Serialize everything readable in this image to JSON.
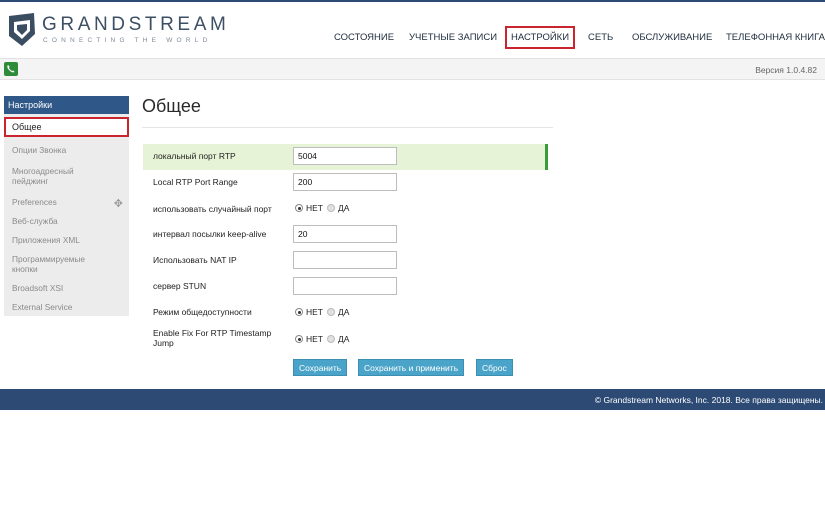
{
  "brand": {
    "name": "GRANDSTREAM",
    "tagline": "CONNECTING THE WORLD"
  },
  "nav": {
    "items": [
      {
        "label": "СОСТОЯНИЕ",
        "active": false
      },
      {
        "label": "УЧЕТНЫЕ ЗАПИСИ",
        "active": false
      },
      {
        "label": "НАСТРОЙКИ",
        "active": true
      },
      {
        "label": "СЕТЬ",
        "active": false
      },
      {
        "label": "ОБСЛУЖИВАНИЕ",
        "active": false
      },
      {
        "label": "ТЕЛЕФОННАЯ КНИГА",
        "active": false
      }
    ]
  },
  "subbar": {
    "icon": "phone-icon",
    "version": "Версия 1.0.4.82"
  },
  "sidebar": {
    "header": "Настройки",
    "active_item": "Общее",
    "items": [
      {
        "label": "Опции Звонка"
      },
      {
        "label": "Многоадресный пейджинг"
      },
      {
        "label": "Preferences",
        "icon": "plus-icon"
      },
      {
        "label": "Веб-служба"
      },
      {
        "label": "Приложения XML"
      },
      {
        "label": "Программируемые кнопки"
      },
      {
        "label": "Broadsoft XSI"
      },
      {
        "label": "External Service"
      }
    ]
  },
  "main": {
    "title": "Общее",
    "fields": {
      "rtp_port": {
        "label": "локальный порт RTP",
        "value": "5004"
      },
      "rtp_range": {
        "label": "Local RTP Port Range",
        "value": "200"
      },
      "random_port": {
        "label": "использовать случайный порт",
        "selected": "НЕТ"
      },
      "keepalive": {
        "label": "интервал посылки keep-alive",
        "value": "20"
      },
      "nat_ip": {
        "label": "Использовать NAT IP",
        "value": ""
      },
      "stun": {
        "label": "сервер STUN",
        "value": ""
      },
      "public_mode": {
        "label": "Режим общедоступности",
        "selected": "НЕТ"
      },
      "rtp_timestamp": {
        "label": "Enable Fix For RTP Timestamp Jump",
        "selected": "НЕТ"
      }
    },
    "radio_options": {
      "no": "НЕТ",
      "yes": "ДА"
    },
    "buttons": {
      "save": "Сохранить",
      "save_apply": "Сохранить и применить",
      "reset": "Сброс"
    }
  },
  "footer": {
    "copyright": "© Grandstream Networks, Inc. 2018. Все права защищены."
  },
  "colors": {
    "brand_blue": "#2c4a74",
    "sidebar_header": "#2f5788",
    "highlight_red": "#c8252f",
    "highlight_row": "#e7f3d6",
    "button": "#4aa3c8"
  }
}
